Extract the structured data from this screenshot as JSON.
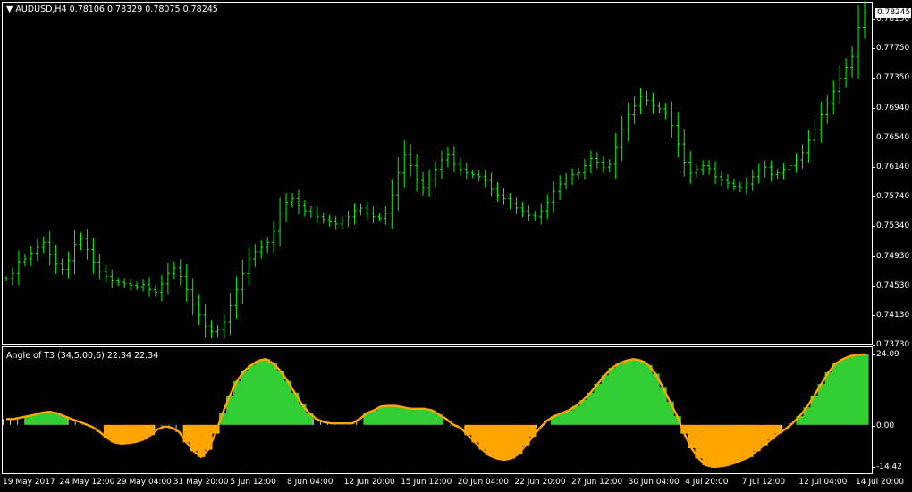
{
  "window": {
    "header_arrow": "▼",
    "symbol": "AUDUSD,H4",
    "ohlc": "0.78106 0.78329 0.78075 0.78245"
  },
  "indicator": {
    "title": "Angle of T3 (34,5.00,6) 22.34 22.34",
    "scale": [
      "24.09",
      "0.00",
      "-14.42"
    ],
    "colors": {
      "up": "#32CD32",
      "down": "#FFA500",
      "line": "#32CD32",
      "line_down": "#FFA500"
    }
  },
  "price_axis": {
    "current_price": "0.78245",
    "ticks": [
      "0.78150",
      "0.77750",
      "0.77350",
      "0.76940",
      "0.76540",
      "0.76140",
      "0.75740",
      "0.75340",
      "0.74930",
      "0.74530",
      "0.74130",
      "0.73730"
    ]
  },
  "time_axis": {
    "labels": [
      "19 May 2017",
      "24 May 12:00",
      "29 May 04:00",
      "31 May 20:00",
      "5 Jun 12:00",
      "8 Jun 04:00",
      "12 Jun 20:00",
      "15 Jun 12:00",
      "20 Jun 04:00",
      "22 Jun 20:00",
      "27 Jun 12:00",
      "30 Jun 04:00",
      "4 Jul 20:00",
      "7 Jul 12:00",
      "12 Jul 04:00",
      "14 Jul 20:00"
    ]
  },
  "chart_data": [
    {
      "type": "line",
      "title": "AUDUSD,H4",
      "series": [
        {
          "name": "AUDUSD,H4",
          "color": "#00FF00",
          "values": [
            0.7455,
            0.7462,
            0.7478,
            0.7482,
            0.749,
            0.7498,
            0.7505,
            0.7488,
            0.7475,
            0.7468,
            0.748,
            0.7502,
            0.751,
            0.7495,
            0.7478,
            0.7465,
            0.7458,
            0.7452,
            0.745,
            0.7448,
            0.7446,
            0.7444,
            0.7447,
            0.744,
            0.7436,
            0.7448,
            0.7462,
            0.747,
            0.7458,
            0.744,
            0.742,
            0.7405,
            0.739,
            0.7382,
            0.7385,
            0.7395,
            0.7418,
            0.744,
            0.7462,
            0.7482,
            0.7492,
            0.7498,
            0.7505,
            0.752,
            0.7545,
            0.756,
            0.7565,
            0.7555,
            0.7548,
            0.7545,
            0.754,
            0.7536,
            0.7533,
            0.753,
            0.7534,
            0.754,
            0.7548,
            0.7552,
            0.7545,
            0.754,
            0.7538,
            0.7545,
            0.757,
            0.76,
            0.7625,
            0.761,
            0.759,
            0.758,
            0.7592,
            0.7605,
            0.7618,
            0.7625,
            0.7612,
            0.7605,
            0.76,
            0.7598,
            0.7595,
            0.759,
            0.7578,
            0.757,
            0.7565,
            0.7558,
            0.7552,
            0.7548,
            0.7542,
            0.754,
            0.7548,
            0.756,
            0.7575,
            0.7585,
            0.7592,
            0.7598,
            0.76,
            0.761,
            0.762,
            0.7615,
            0.7608,
            0.7612,
            0.7635,
            0.766,
            0.768,
            0.7692,
            0.7705,
            0.77,
            0.7692,
            0.7688,
            0.7682,
            0.7665,
            0.764,
            0.7615,
            0.76,
            0.7605,
            0.761,
            0.7606,
            0.7595,
            0.759,
            0.7586,
            0.7582,
            0.758,
            0.7585,
            0.7595,
            0.7603,
            0.7608,
            0.7598,
            0.76,
            0.7605,
            0.761,
            0.7618,
            0.7628,
            0.7645,
            0.766,
            0.768,
            0.7695,
            0.7712,
            0.773,
            0.7745,
            0.776,
            0.78,
            0.782
          ]
        }
      ],
      "y_scale": {
        "min": 0.7373,
        "max": 0.7824
      }
    },
    {
      "type": "area",
      "title": "Angle of T3 (34,5.00,6) 22.34 22.34",
      "series": [
        {
          "name": "Angle of T3",
          "values": [
            2,
            2,
            2.5,
            3,
            3.5,
            4.2,
            4.5,
            4,
            3,
            2,
            1.2,
            0.2,
            -0.8,
            -2.5,
            -4.5,
            -6,
            -6.4,
            -6.2,
            -5.8,
            -5,
            -3.5,
            -1.5,
            -0.5,
            -1,
            -2.5,
            -6,
            -9,
            -11,
            -8.5,
            -3,
            4,
            10,
            15,
            18.5,
            20.5,
            22,
            22.5,
            21,
            18.5,
            15,
            11,
            7,
            4,
            2,
            1,
            0.5,
            0.5,
            0.5,
            0.5,
            2,
            4,
            5,
            6.3,
            6.5,
            6.5,
            6,
            5.5,
            5.5,
            5.5,
            5,
            3.5,
            2,
            0,
            -1,
            -3.5,
            -6,
            -8.5,
            -10.5,
            -11.5,
            -12,
            -11.5,
            -10,
            -7,
            -4,
            -1,
            1.5,
            3,
            4,
            5,
            6.5,
            8.5,
            11,
            14,
            17,
            19.5,
            21,
            22,
            22.5,
            22,
            20.5,
            17.5,
            13,
            8,
            3,
            -3,
            -8,
            -11.5,
            -13.8,
            -14.4,
            -14.2,
            -13.8,
            -13,
            -12,
            -11,
            -9,
            -7,
            -5,
            -3,
            -1.5,
            0.5,
            3,
            6,
            10,
            14,
            18,
            21,
            22.5,
            23.5,
            24,
            24.09
          ]
        }
      ],
      "ylim": [
        -14.42,
        24.09
      ]
    }
  ]
}
